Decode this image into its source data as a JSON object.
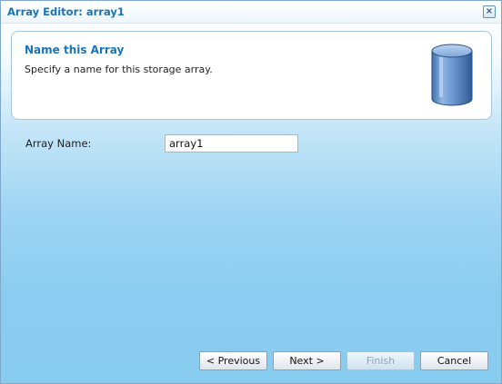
{
  "window": {
    "title": "Array Editor: array1",
    "close_label": "×"
  },
  "header": {
    "title": "Name this Array",
    "subtitle": "Specify a name for this storage array.",
    "icon": "storage-cylinder-icon"
  },
  "form": {
    "array_name_label": "Array Name:",
    "array_name_value": "array1"
  },
  "buttons": {
    "previous": "< Previous",
    "next": "Next >",
    "finish": "Finish",
    "cancel": "Cancel"
  },
  "colors": {
    "title_blue": "#1a74b8",
    "background_blue": "#8bcdf0"
  }
}
